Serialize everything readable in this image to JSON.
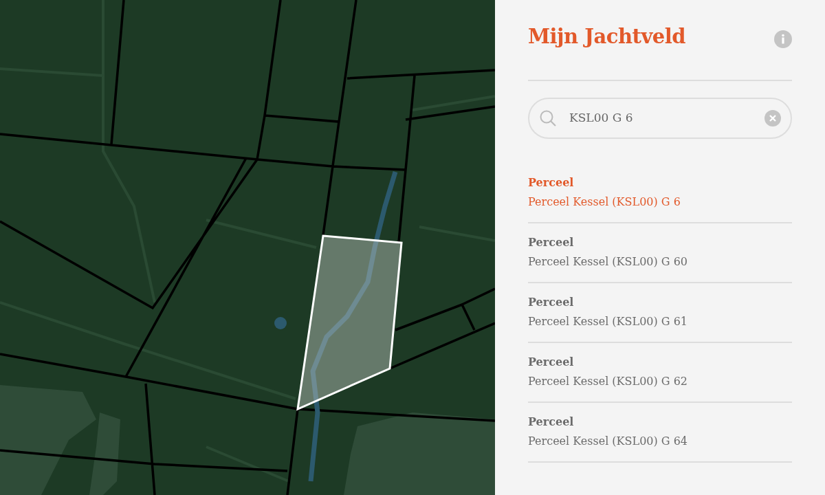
{
  "sidebar": {
    "title": "Mijn Jachtveld",
    "search": {
      "value": "KSL00 G 6"
    },
    "results": [
      {
        "type": "Perceel",
        "label": "Perceel Kessel (KSL00) G 6",
        "selected": true
      },
      {
        "type": "Perceel",
        "label": "Perceel Kessel (KSL00) G 60",
        "selected": false
      },
      {
        "type": "Perceel",
        "label": "Perceel Kessel (KSL00) G 61",
        "selected": false
      },
      {
        "type": "Perceel",
        "label": "Perceel Kessel (KSL00) G 62",
        "selected": false
      },
      {
        "type": "Perceel",
        "label": "Perceel Kessel (KSL00) G 64",
        "selected": false
      }
    ]
  }
}
